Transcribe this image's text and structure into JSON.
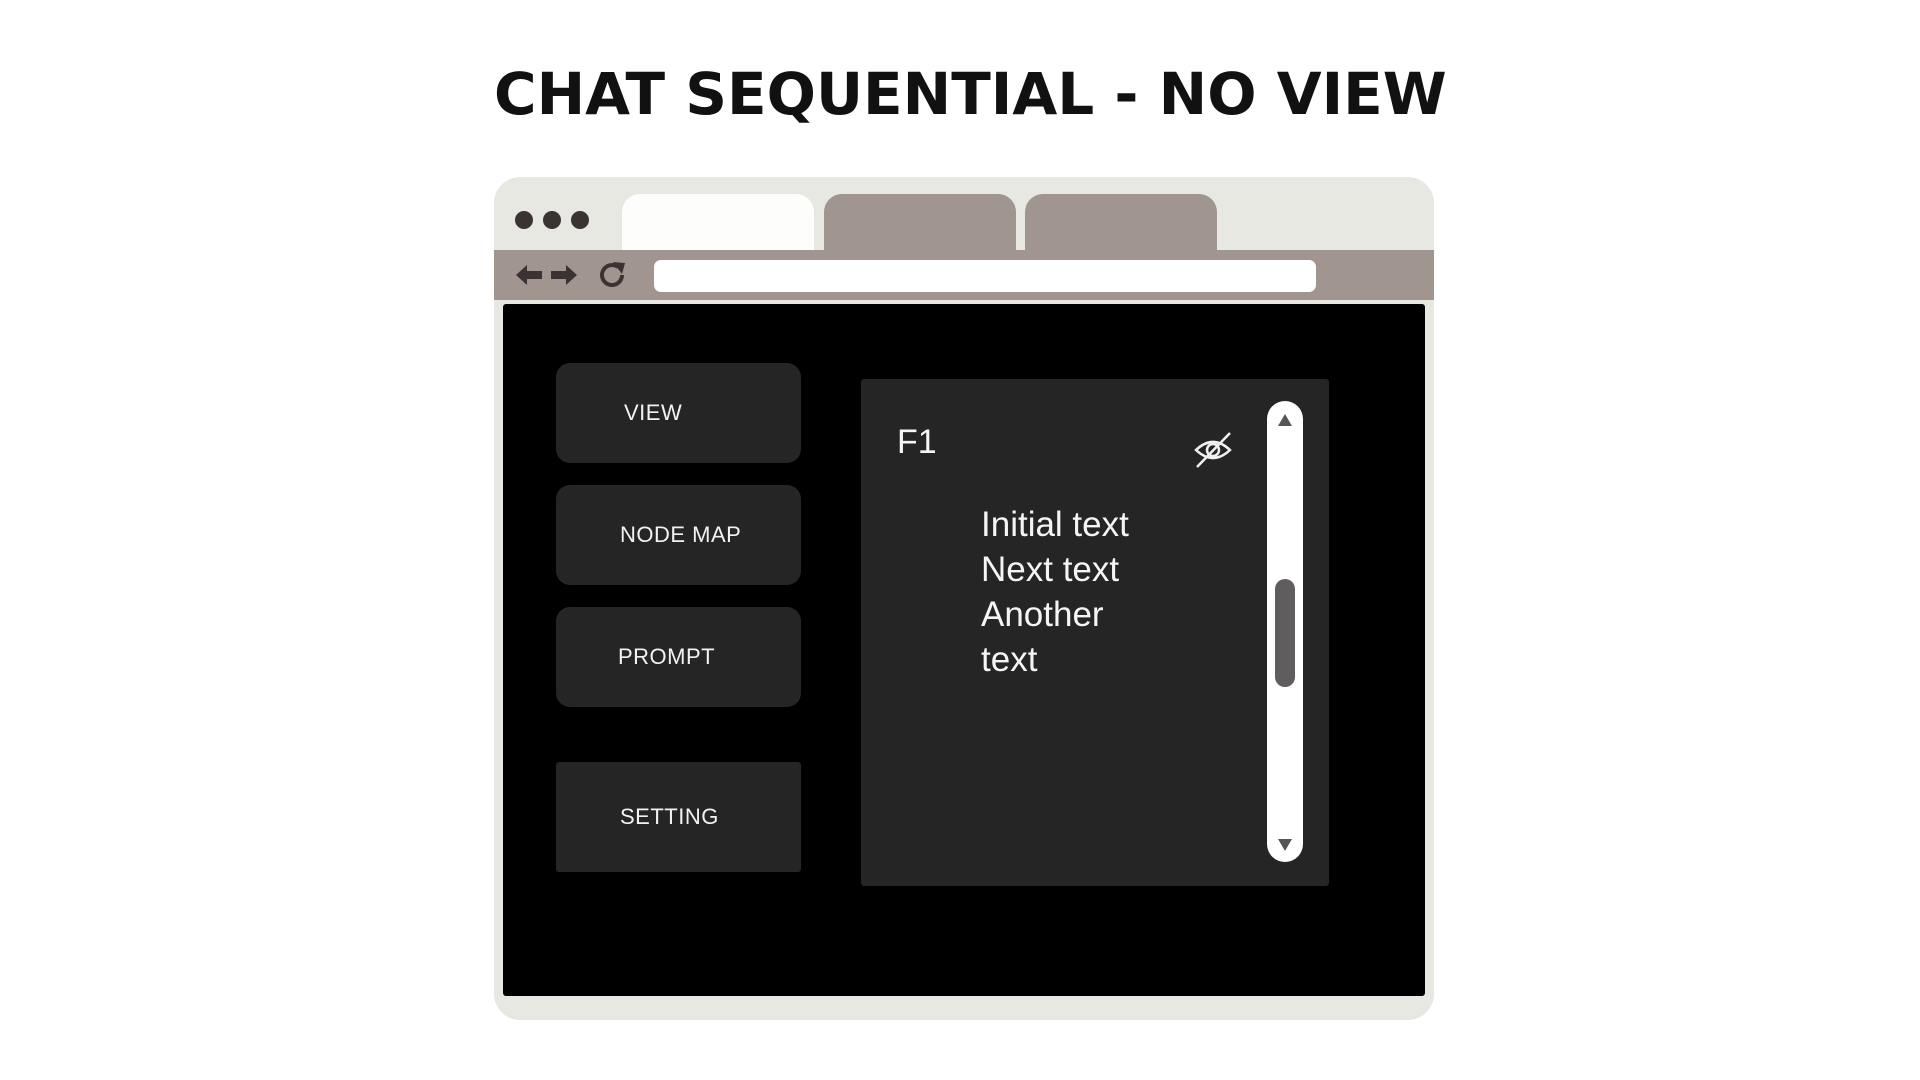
{
  "page": {
    "title": "CHAT SEQUENTIAL - NO VIEW"
  },
  "browser": {
    "tabs": [
      {
        "state": "active"
      },
      {
        "state": "inactive"
      },
      {
        "state": "inactive"
      }
    ],
    "address_bar": {
      "value": ""
    },
    "icons": [
      "back-arrow-icon",
      "forward-arrow-icon",
      "reload-icon"
    ]
  },
  "sidebar": {
    "buttons": [
      {
        "label": "VIEW"
      },
      {
        "label": "NODE MAP"
      },
      {
        "label": "PROMPT"
      },
      {
        "label": "SETTING"
      }
    ]
  },
  "panel": {
    "label": "F1",
    "visibility_icon": "eye-off-icon",
    "lines": [
      "Initial text",
      "Next text",
      "Another",
      "text"
    ]
  },
  "colors": {
    "browser_frame": "#e8e8e3",
    "toolbar": "#a0958f",
    "viewport": "#000000",
    "button": "#262526",
    "text": "#f5f5f5"
  }
}
